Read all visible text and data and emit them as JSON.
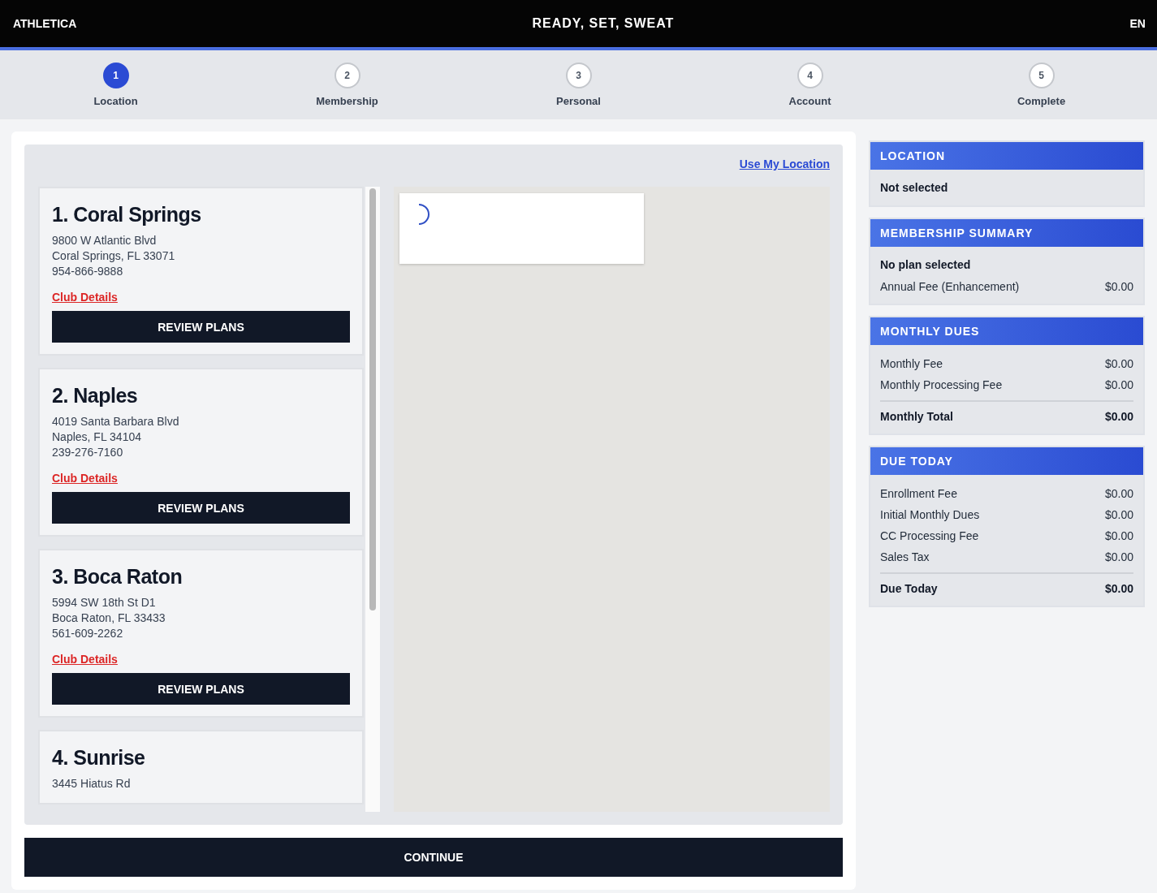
{
  "header": {
    "brand": "ATHLETICA",
    "title": "READY, SET, SWEAT",
    "language": "EN"
  },
  "steps": [
    {
      "number": "1",
      "label": "Location",
      "selected": true
    },
    {
      "number": "2",
      "label": "Membership",
      "selected": false
    },
    {
      "number": "3",
      "label": "Personal",
      "selected": false
    },
    {
      "number": "4",
      "label": "Account",
      "selected": false
    },
    {
      "number": "5",
      "label": "Complete",
      "selected": false
    }
  ],
  "use_location_link": "Use My Location",
  "locations": [
    {
      "name": "1. Coral Springs",
      "lines": [
        "9800 W Atlantic Blvd",
        "Coral Springs, FL 33071",
        "954-866-9888"
      ],
      "details_link": "Club Details",
      "button": "REVIEW PLANS"
    },
    {
      "name": "2. Naples",
      "lines": [
        "4019 Santa Barbara Blvd",
        "Naples, FL 34104",
        "239-276-7160"
      ],
      "details_link": "Club Details",
      "button": "REVIEW PLANS"
    },
    {
      "name": "3. Boca Raton",
      "lines": [
        "5994 SW 18th St D1",
        "Boca Raton, FL 33433",
        "561-609-2262"
      ],
      "details_link": "Club Details",
      "button": "REVIEW PLANS"
    },
    {
      "name": "4. Sunrise",
      "lines": [
        "3445 Hiatus Rd"
      ]
    }
  ],
  "continue_button": "CONTINUE",
  "summary": [
    {
      "title": "LOCATION",
      "rows": [
        {
          "kind": "note",
          "label": "Not selected"
        }
      ]
    },
    {
      "title": "MEMBERSHIP SUMMARY",
      "rows": [
        {
          "kind": "note",
          "label": "No plan selected"
        },
        {
          "kind": "line",
          "label": "Annual Fee (Enhancement)",
          "amount": "$0.00"
        }
      ]
    },
    {
      "title": "MONTHLY DUES",
      "rows": [
        {
          "kind": "line",
          "label": "Monthly Fee",
          "amount": "$0.00"
        },
        {
          "kind": "line",
          "label": "Monthly Processing Fee",
          "amount": "$0.00"
        },
        {
          "kind": "total",
          "label": "Monthly Total",
          "amount": "$0.00"
        }
      ]
    },
    {
      "title": "DUE TODAY",
      "rows": [
        {
          "kind": "line",
          "label": "Enrollment Fee",
          "amount": "$0.00"
        },
        {
          "kind": "line",
          "label": "Initial Monthly Dues",
          "amount": "$0.00"
        },
        {
          "kind": "line",
          "label": "CC Processing Fee",
          "amount": "$0.00"
        },
        {
          "kind": "line",
          "label": "Sales Tax",
          "amount": "$0.00"
        },
        {
          "kind": "total",
          "label": "Due Today",
          "amount": "$0.00"
        }
      ]
    }
  ]
}
